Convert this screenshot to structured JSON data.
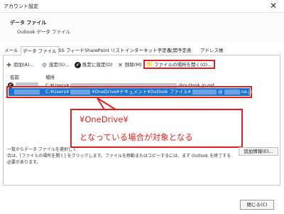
{
  "window": {
    "title": "アカウント設定",
    "close_glyph": "✕"
  },
  "section": {
    "heading": "データ ファイル",
    "subheading": "Outlook データ ファイル"
  },
  "tabs": [
    {
      "label": "メール",
      "active": false
    },
    {
      "label": "データ ファイル",
      "active": true
    },
    {
      "label": "RSS フィード",
      "active": false
    },
    {
      "label": "SharePoint リスト",
      "active": false
    },
    {
      "label": "インターネット予定表",
      "active": false
    },
    {
      "label": "公開予定表",
      "active": false
    },
    {
      "label": "アドレス帳",
      "active": false
    }
  ],
  "toolbar": {
    "add": "追加(A)...",
    "settings": "設定(S)...",
    "set_default": "既定に設定(D)",
    "remove": "削除(M)",
    "open_location": "ファイルの場所を開く(O)..."
  },
  "list": {
    "columns": {
      "name": "名前",
      "location": "場所"
    },
    "rows": [
      {
        "path_start": "C:¥Users¥",
        "path_end": "@outlook.jp.ost",
        "default": true,
        "selected": false
      },
      {
        "path_start": "C:¥Users¥",
        "path_mid": "¥OneDrive¥ドキュメント¥Outlook ファイル¥",
        "path_end": "ne.jp.pst",
        "path_at": "@",
        "default": false,
        "selected": true
      }
    ]
  },
  "callout": {
    "line1": "¥OneDrive¥",
    "line2": "となっている場合が対象となる",
    "color": "#e02020"
  },
  "description": {
    "line1": "一覧からデータ ファイルを選択して",
    "line2": "合は、[ファイルの場所を開く] をクリックします。ファイルを移動またはコピーするには、まず Outlook を終了する必要があります。"
  },
  "buttons": {
    "more_info": "追加情報(E)...",
    "close": "閉じる(C)"
  },
  "colors": {
    "selection": "#1e72d2",
    "highlight": "#e02020"
  }
}
